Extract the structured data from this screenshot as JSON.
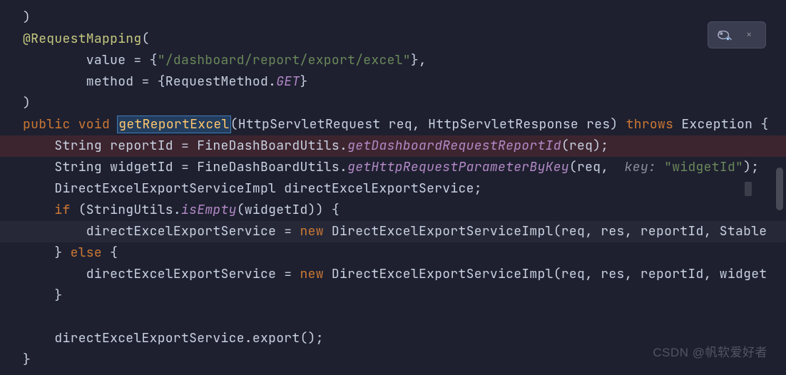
{
  "toolbar": {
    "icon": "inspect-icon",
    "close": "×"
  },
  "watermark": "CSDN @帆软爱好者",
  "code": {
    "l1": ")",
    "l2_ann": "@RequestMapping",
    "l2_paren": "(",
    "l3_pre": "        value = {",
    "l3_str": "\"/dashboard/report/export/excel\"",
    "l3_post": "},",
    "l4_pre": "        method = {RequestMethod.",
    "l4_const": "GET",
    "l4_post": "}",
    "l5": ")",
    "l6_public": "public",
    "l6_void": " void ",
    "l6_method": "getReportExcel",
    "l6_params": "(HttpServletRequest req, HttpServletResponse res) ",
    "l6_throws": "throws",
    "l6_exc": " Exception {",
    "l7_pre": "    String reportId = FineDashBoardUtils.",
    "l7_m": "getDashboardRequestReportId",
    "l7_post": "(req);",
    "l8_pre": "    String widgetId = FineDashBoardUtils.",
    "l8_m": "getHttpRequestParameterByKey",
    "l8_post1": "(req, ",
    "l8_label": " key: ",
    "l8_str": "\"widgetId\"",
    "l8_post2": ");",
    "l9": "    DirectExcelExportServiceImpl directExcelExportService;",
    "l10_if": "    if ",
    "l10_pre": "(StringUtils.",
    "l10_m": "isEmpty",
    "l10_post": "(widgetId)) {",
    "l11_pre": "        directExcelExportService = ",
    "l11_new": "new",
    "l11_post": " DirectExcelExportServiceImpl(req, res, reportId, Stable",
    "l12_pre": "    } ",
    "l12_else": "else",
    "l12_post": " {",
    "l13_pre": "        directExcelExportService = ",
    "l13_new": "new",
    "l13_post": " DirectExcelExportServiceImpl(req, res, reportId, widget",
    "l14": "    }",
    "l15": "",
    "l16": "    directExcelExportService.export();",
    "l17": "}"
  }
}
